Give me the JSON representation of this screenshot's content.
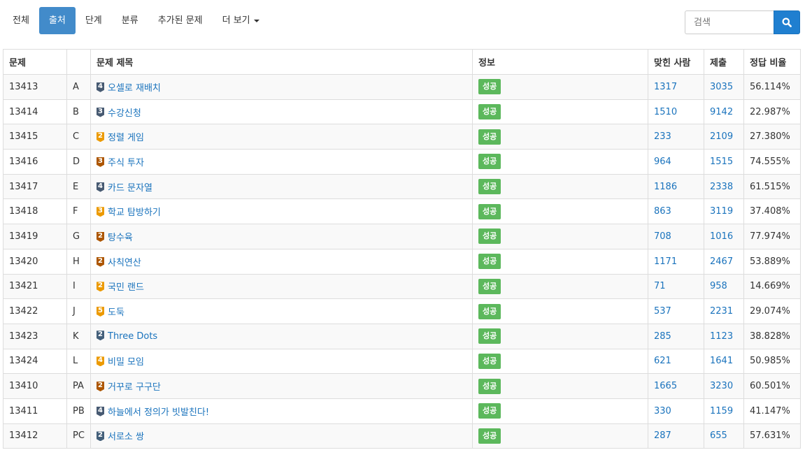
{
  "nav": {
    "tabs": [
      {
        "label": "전체",
        "active": false
      },
      {
        "label": "출처",
        "active": true
      },
      {
        "label": "단계",
        "active": false
      },
      {
        "label": "분류",
        "active": false
      },
      {
        "label": "추가된 문제",
        "active": false
      },
      {
        "label": "더 보기",
        "active": false,
        "dropdown": true
      }
    ]
  },
  "search": {
    "placeholder": "검색",
    "icon": "search-icon"
  },
  "colors": {
    "accent": "#428bca",
    "link": "#1a73bd",
    "success": "#5cb85c",
    "tier_platinum": "#475a72",
    "tier_gold": "#ec9a00",
    "tier_silver": "#435f7a",
    "tier_bronze": "#ad5600"
  },
  "table": {
    "headers": {
      "id": "문제",
      "label": "",
      "title": "문제 제목",
      "info": "정보",
      "solved": "맞힌 사람",
      "submissions": "제출",
      "ratio": "정답 비율"
    },
    "rows": [
      {
        "id": "13413",
        "label": "A",
        "tier": "4",
        "tier_color": "#475a72",
        "title": "오셀로 재배치",
        "status": "성공",
        "solved": "1317",
        "submissions": "3035",
        "ratio": "56.114%"
      },
      {
        "id": "13414",
        "label": "B",
        "tier": "3",
        "tier_color": "#475a72",
        "title": "수강신청",
        "status": "성공",
        "solved": "1510",
        "submissions": "9142",
        "ratio": "22.987%"
      },
      {
        "id": "13415",
        "label": "C",
        "tier": "2",
        "tier_color": "#ec9a00",
        "title": "정렬 게임",
        "status": "성공",
        "solved": "233",
        "submissions": "2109",
        "ratio": "27.380%"
      },
      {
        "id": "13416",
        "label": "D",
        "tier": "3",
        "tier_color": "#ad5600",
        "title": "주식 투자",
        "status": "성공",
        "solved": "964",
        "submissions": "1515",
        "ratio": "74.555%"
      },
      {
        "id": "13417",
        "label": "E",
        "tier": "4",
        "tier_color": "#475a72",
        "title": "카드 문자열",
        "status": "성공",
        "solved": "1186",
        "submissions": "2338",
        "ratio": "61.515%"
      },
      {
        "id": "13418",
        "label": "F",
        "tier": "3",
        "tier_color": "#ec9a00",
        "title": "학교 탐방하기",
        "status": "성공",
        "solved": "863",
        "submissions": "3119",
        "ratio": "37.408%"
      },
      {
        "id": "13419",
        "label": "G",
        "tier": "2",
        "tier_color": "#ad5600",
        "title": "탕수육",
        "status": "성공",
        "solved": "708",
        "submissions": "1016",
        "ratio": "77.974%"
      },
      {
        "id": "13420",
        "label": "H",
        "tier": "2",
        "tier_color": "#ad5600",
        "title": "사칙연산",
        "status": "성공",
        "solved": "1171",
        "submissions": "2467",
        "ratio": "53.889%"
      },
      {
        "id": "13421",
        "label": "I",
        "tier": "2",
        "tier_color": "#ec9a00",
        "title": "국민 랜드",
        "status": "성공",
        "solved": "71",
        "submissions": "958",
        "ratio": "14.669%"
      },
      {
        "id": "13422",
        "label": "J",
        "tier": "5",
        "tier_color": "#ec9a00",
        "title": "도둑",
        "status": "성공",
        "solved": "537",
        "submissions": "2231",
        "ratio": "29.074%"
      },
      {
        "id": "13423",
        "label": "K",
        "tier": "2",
        "tier_color": "#435f7a",
        "title": "Three Dots",
        "status": "성공",
        "solved": "285",
        "submissions": "1123",
        "ratio": "38.828%"
      },
      {
        "id": "13424",
        "label": "L",
        "tier": "4",
        "tier_color": "#ec9a00",
        "title": "비밀 모임",
        "status": "성공",
        "solved": "621",
        "submissions": "1641",
        "ratio": "50.985%"
      },
      {
        "id": "13410",
        "label": "PA",
        "tier": "2",
        "tier_color": "#ad5600",
        "title": "거꾸로 구구단",
        "status": "성공",
        "solved": "1665",
        "submissions": "3230",
        "ratio": "60.501%"
      },
      {
        "id": "13411",
        "label": "PB",
        "tier": "4",
        "tier_color": "#475a72",
        "title": "하늘에서 정의가 빗발친다!",
        "status": "성공",
        "solved": "330",
        "submissions": "1159",
        "ratio": "41.147%"
      },
      {
        "id": "13412",
        "label": "PC",
        "tier": "2",
        "tier_color": "#435f7a",
        "title": "서로소 쌍",
        "status": "성공",
        "solved": "287",
        "submissions": "655",
        "ratio": "57.631%"
      }
    ]
  }
}
